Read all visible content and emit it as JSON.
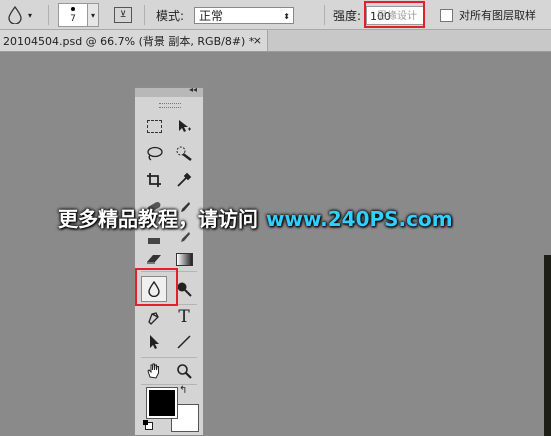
{
  "options_bar": {
    "tool_icon": "blur-drop-icon",
    "brush_size": "7",
    "mode_label": "模式:",
    "mode_value": "正常",
    "strength_label": "强度:",
    "strength_value": "100",
    "sample_all_label": "对所有图层取样",
    "overlay_watermark": "思缘设计论坛"
  },
  "tabs": [
    {
      "label": "20104504.psd @ 66.7% (背景 副本, RGB/8#) *",
      "close": "×"
    }
  ],
  "toolbox": {
    "collapse_glyph": "◂◂",
    "tools": [
      {
        "name": "rect-marquee-icon",
        "glyph": "⬚"
      },
      {
        "name": "move-icon",
        "glyph": "▶"
      },
      {
        "name": "lasso-icon",
        "glyph": "◯"
      },
      {
        "name": "quick-select-icon",
        "glyph": "✎"
      },
      {
        "name": "crop-icon",
        "glyph": "⌗"
      },
      {
        "name": "eyedropper-icon",
        "glyph": "✒"
      },
      {
        "name": "eraser-icon",
        "glyph": "▰"
      },
      {
        "name": "gradient-icon",
        "glyph": "▮"
      },
      {
        "name": "blur-icon",
        "glyph": "💧"
      },
      {
        "name": "dodge-icon",
        "glyph": "●"
      },
      {
        "name": "pen-icon",
        "glyph": "✒"
      },
      {
        "name": "type-icon",
        "glyph": "T"
      },
      {
        "name": "path-select-icon",
        "glyph": "➤"
      },
      {
        "name": "line-icon",
        "glyph": "╱"
      },
      {
        "name": "hand-icon",
        "glyph": "✋"
      },
      {
        "name": "zoom-icon",
        "glyph": "🔍"
      }
    ],
    "foreground_color": "#000000",
    "background_color": "#ffffff"
  },
  "watermark": {
    "text": "更多精品教程，请访问",
    "site": "www.240PS.com"
  },
  "colors": {
    "highlight": "#e0202a",
    "canvas": "#8a8a8a"
  }
}
